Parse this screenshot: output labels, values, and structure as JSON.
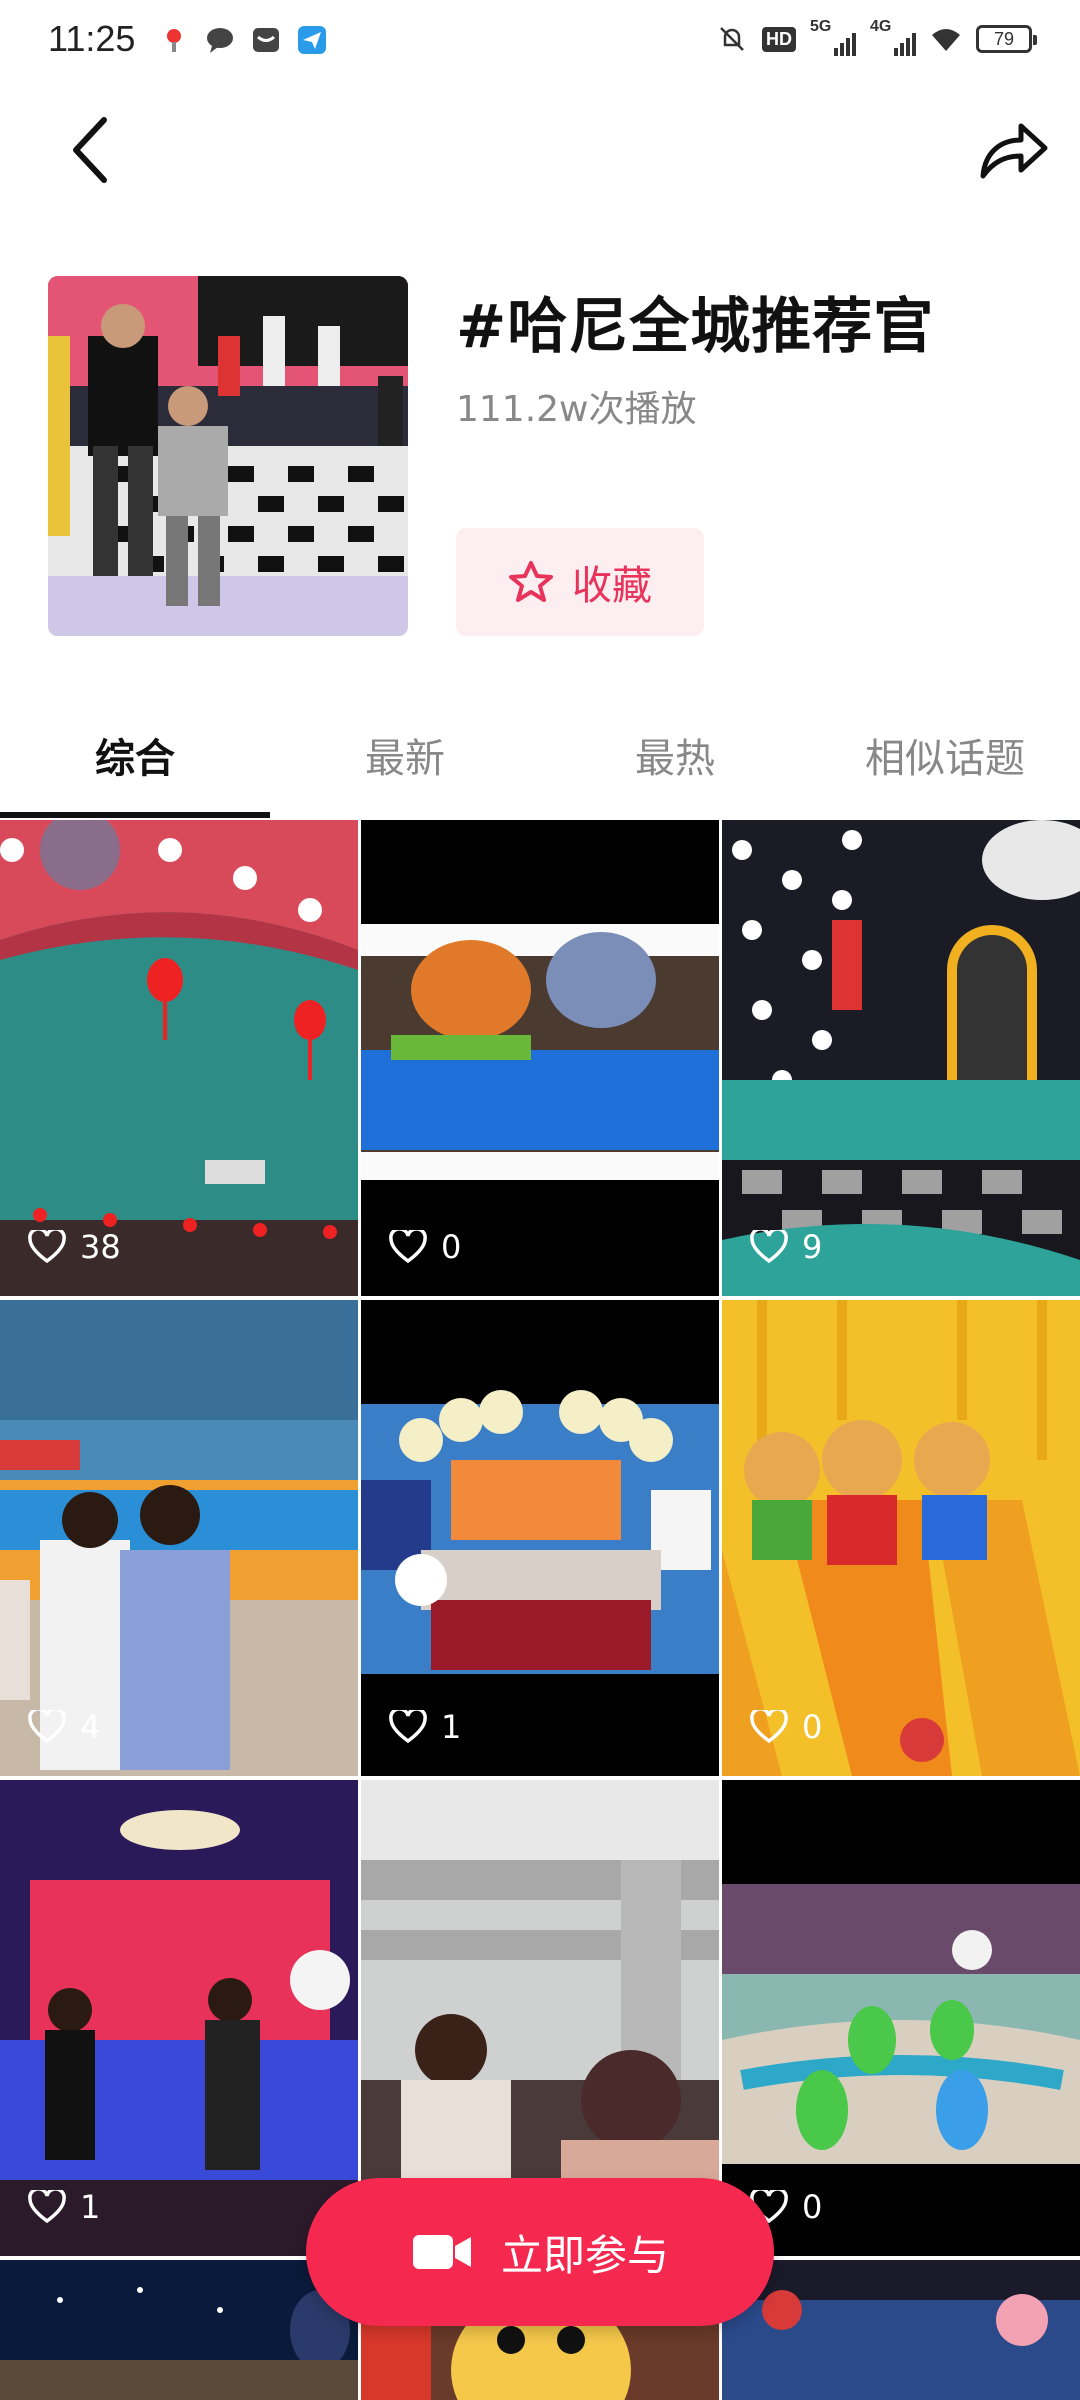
{
  "status_bar": {
    "time": "11:25",
    "hd_label": "HD",
    "net1": "5G",
    "net2": "4G",
    "battery": "79"
  },
  "nav": {
    "back_icon": "back-chevron-icon",
    "share_icon": "share-arrow-icon"
  },
  "topic": {
    "title": "#哈尼全城推荐官",
    "play_count": "111.2w次播放",
    "favorite_label": "收藏"
  },
  "tabs": [
    {
      "label": "综合",
      "active": true
    },
    {
      "label": "最新",
      "active": false
    },
    {
      "label": "最热",
      "active": false
    },
    {
      "label": "相似话题",
      "active": false
    }
  ],
  "videos": [
    {
      "likes": "38"
    },
    {
      "likes": "0"
    },
    {
      "likes": "9"
    },
    {
      "likes": "4"
    },
    {
      "likes": "1"
    },
    {
      "likes": "0"
    },
    {
      "likes": "1"
    },
    {
      "likes": ""
    },
    {
      "likes": "0"
    }
  ],
  "cta": {
    "label": "立即参与",
    "icon": "video-camera-icon"
  },
  "colors": {
    "accent": "#f5294f",
    "fav_bg": "#fdeef1",
    "fav_text": "#e8345a"
  }
}
